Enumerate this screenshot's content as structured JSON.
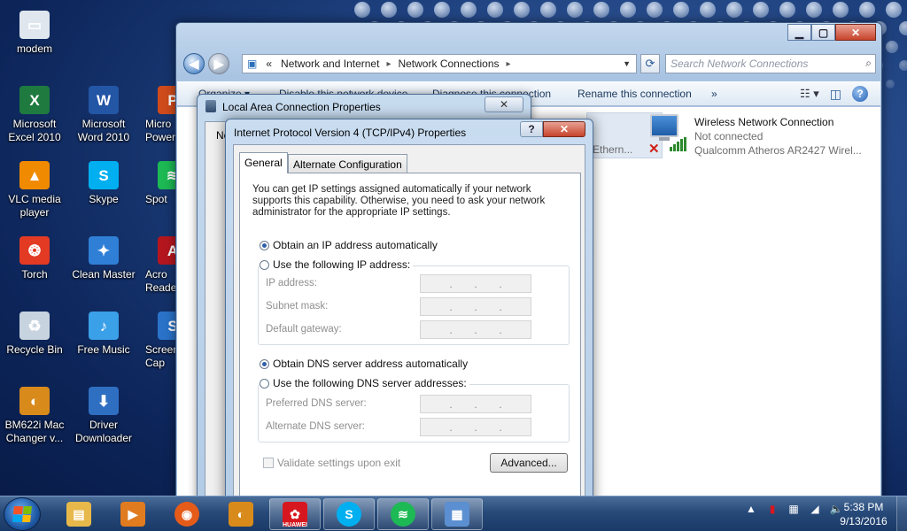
{
  "desktop": {
    "icons": [
      {
        "label": "modem",
        "icon": "modem-icon",
        "color": "#dfe6ee"
      },
      {
        "label": "Microsoft Excel 2010",
        "icon": "excel-icon",
        "color": "#1f7a3f"
      },
      {
        "label": "Microsoft Word 2010",
        "icon": "word-icon",
        "color": "#2456a6"
      },
      {
        "label": "Micro Power",
        "icon": "powerpoint-icon",
        "color": "#cf4b1c"
      },
      {
        "label": "VLC media player",
        "icon": "vlc-icon",
        "color": "#f08a00"
      },
      {
        "label": "Skype",
        "icon": "skype-icon",
        "color": "#00aff0"
      },
      {
        "label": "Spot",
        "icon": "spotify-icon",
        "color": "#1db954"
      },
      {
        "label": "Torch",
        "icon": "torch-icon",
        "color": "#e33a24"
      },
      {
        "label": "Clean Master",
        "icon": "clean-master-icon",
        "color": "#2f7fd6"
      },
      {
        "label": "Acro Reade",
        "icon": "acrobat-reader-icon",
        "color": "#b5161e"
      },
      {
        "label": "Recycle Bin",
        "icon": "recycle-bin-icon",
        "color": "#c7d4df"
      },
      {
        "label": "Free Music",
        "icon": "free-music-icon",
        "color": "#3aa0e8"
      },
      {
        "label": "Screen Cap",
        "icon": "screen-capture-icon",
        "color": "#2a73c9"
      },
      {
        "label": "BM622i Mac Changer v...",
        "icon": "mac-changer-icon",
        "color": "#d88a1b"
      },
      {
        "label": "Driver Downloader",
        "icon": "driver-downloader-icon",
        "color": "#2f6fc2"
      }
    ]
  },
  "explorer": {
    "address": {
      "prefix": "«",
      "segments": [
        "Network and Internet",
        "Network Connections"
      ]
    },
    "search_placeholder": "Search Network Connections",
    "commands": {
      "organize": "Organize ▾",
      "disable": "Disable this network device",
      "diagnose": "Diagnose this connection",
      "rename": "Rename this connection",
      "more": "»"
    },
    "ethernet_partial": "Ethern...",
    "wireless": {
      "title": "Wireless Network Connection",
      "status": "Not connected",
      "adapter": "Qualcomm Atheros AR2427 Wirel..."
    }
  },
  "lac_dialog": {
    "title": "Local Area Connection Properties",
    "tab_stub": "Ne"
  },
  "ipv4_dialog": {
    "title": "Internet Protocol Version 4 (TCP/IPv4) Properties",
    "help": "?",
    "tabs": [
      "General",
      "Alternate Configuration"
    ],
    "description": "You can get IP settings assigned automatically if your network supports this capability. Otherwise, you need to ask your network administrator for the appropriate IP settings.",
    "ip_auto": "Obtain an IP address automatically",
    "ip_manual": "Use the following IP address:",
    "ip_fields": [
      {
        "label": "IP address:"
      },
      {
        "label": "Subnet mask:"
      },
      {
        "label": "Default gateway:"
      }
    ],
    "dns_auto": "Obtain DNS server address automatically",
    "dns_manual": "Use the following DNS server addresses:",
    "dns_fields": [
      {
        "label": "Preferred DNS server:"
      },
      {
        "label": "Alternate DNS server:"
      }
    ],
    "validate": "Validate settings upon exit",
    "advanced": "Advanced...",
    "selected_ip_mode": "auto",
    "selected_dns_mode": "auto"
  },
  "taskbar": {
    "items": [
      {
        "icon": "windows-explorer-icon",
        "color": "#e8b94a",
        "open": false
      },
      {
        "icon": "media-player-icon",
        "color": "#e07b1f",
        "open": false
      },
      {
        "icon": "firefox-icon",
        "color": "#e55b1a",
        "open": false
      },
      {
        "icon": "mac-changer-icon",
        "color": "#d88a1b",
        "open": false
      },
      {
        "icon": "huawei-icon",
        "color": "#d7171f",
        "open": true,
        "caption": "HUAWEI"
      },
      {
        "icon": "skype-icon",
        "color": "#00aff0",
        "open": true
      },
      {
        "icon": "spotify-icon",
        "color": "#1db954",
        "open": true
      },
      {
        "icon": "network-connections-icon",
        "color": "#5b8fd1",
        "open": true
      }
    ],
    "time": "5:38 PM",
    "date": "9/13/2016"
  },
  "colors": {
    "accent": "#2e5fa8",
    "link": "#1c3a60"
  }
}
